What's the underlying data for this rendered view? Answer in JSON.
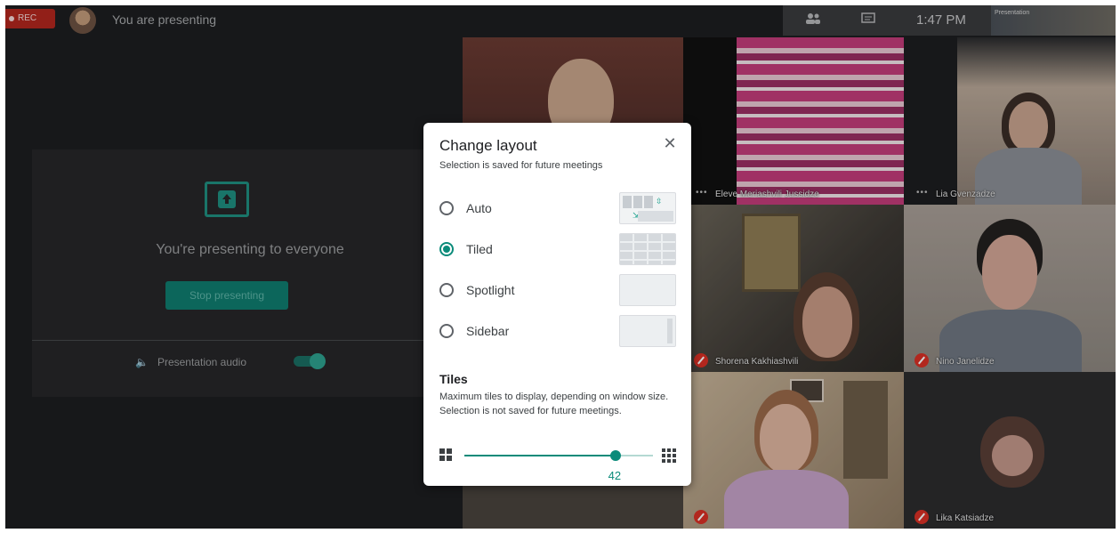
{
  "topbar": {
    "rec_label": "REC",
    "title": "You are presenting",
    "clock": "1:47 PM",
    "self_name": "Presentation"
  },
  "presenting": {
    "message": "You're presenting to everyone",
    "stop_label": "Stop presenting",
    "audio_label": "Presentation audio",
    "audio_on": true
  },
  "tiles": {
    "tile2_name": "Eleve Meriashvili Jussidze",
    "tile3_name": "Lia Gvenzadze",
    "tile5_name": "Shorena Kakhiashvili",
    "tile6_name": "Nino Janelidze",
    "tile9_name": "Lika Katsiadze"
  },
  "dialog": {
    "title": "Change layout",
    "subtitle": "Selection is saved for future meetings",
    "close_icon": "✕",
    "options": [
      {
        "label": "Auto",
        "selected": false
      },
      {
        "label": "Tiled",
        "selected": true
      },
      {
        "label": "Spotlight",
        "selected": false
      },
      {
        "label": "Sidebar",
        "selected": false
      }
    ],
    "tiles_title": "Tiles",
    "tiles_desc_1": "Maximum tiles to display, depending on window size.",
    "tiles_desc_2": "Selection is not saved for future meetings.",
    "slider": {
      "value": "42",
      "fraction": 0.8
    }
  },
  "colors": {
    "accent": "#0b8b7a",
    "rec": "#b3261e",
    "background": "#1d1e20"
  }
}
